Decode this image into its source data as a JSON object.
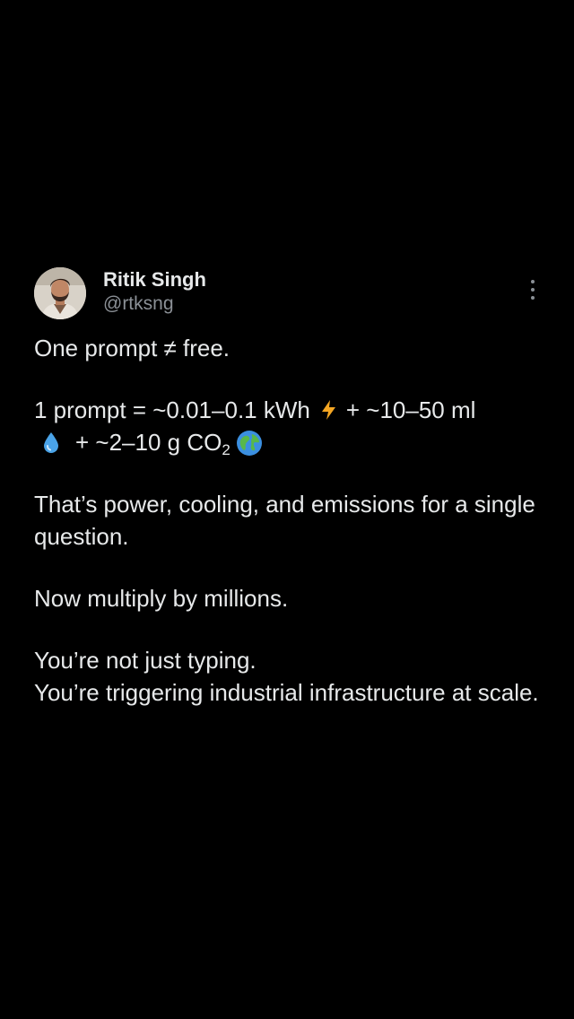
{
  "author": {
    "display_name": "Ritik Singh",
    "handle": "@rtksng"
  },
  "tweet": {
    "line1": "One prompt ≠ free.",
    "stats": {
      "part1": "1 prompt = ~0.01–0.1 kWh",
      "part2": "+ ~10–50 ml",
      "part3": "+ ~2–10 g CO",
      "part3_sub": "2"
    },
    "line3": "That’s power, cooling, and emissions for a single question.",
    "line4": "Now multiply by millions.",
    "line5a": "You’re not just typing.",
    "line5b": "You’re triggering industrial infrastructure at scale."
  },
  "icons": {
    "more": "more-vertical-icon",
    "lightning": "high-voltage-emoji",
    "droplet": "droplet-emoji",
    "globe": "globe-emoji"
  },
  "colors": {
    "background": "#000000",
    "text": "#e7e9ea",
    "secondary": "#8b9096"
  }
}
